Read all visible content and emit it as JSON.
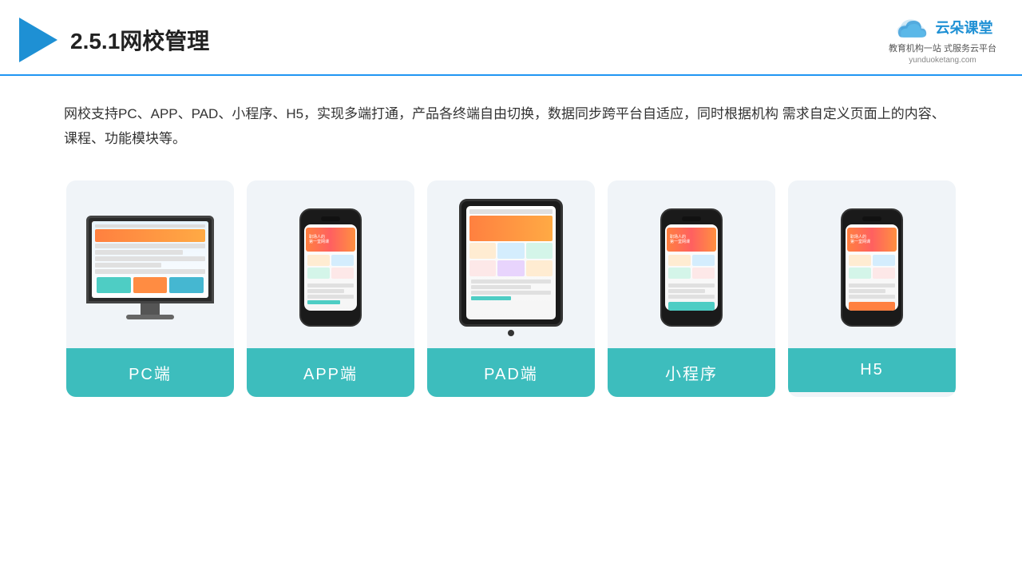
{
  "header": {
    "title": "2.5.1网校管理",
    "brand": {
      "name": "云朵课堂",
      "url": "yunduoketang.com",
      "tagline": "教育机构一站\n式服务云平台"
    }
  },
  "description": {
    "text": "网校支持PC、APP、PAD、小程序、H5，实现多端打通，产品各终端自由切换，数据同步跨平台自适应，同时根据机构\n需求自定义页面上的内容、课程、功能模块等。"
  },
  "cards": [
    {
      "id": 1,
      "label": "PC端",
      "device": "pc"
    },
    {
      "id": 2,
      "label": "APP端",
      "device": "phone"
    },
    {
      "id": 3,
      "label": "PAD端",
      "device": "tablet"
    },
    {
      "id": 4,
      "label": "小程序",
      "device": "phone"
    },
    {
      "id": 5,
      "label": "H5",
      "device": "phone"
    }
  ],
  "colors": {
    "accent_blue": "#1e90d4",
    "accent_teal": "#3dbdbd",
    "bg_card": "#f0f4f8"
  }
}
